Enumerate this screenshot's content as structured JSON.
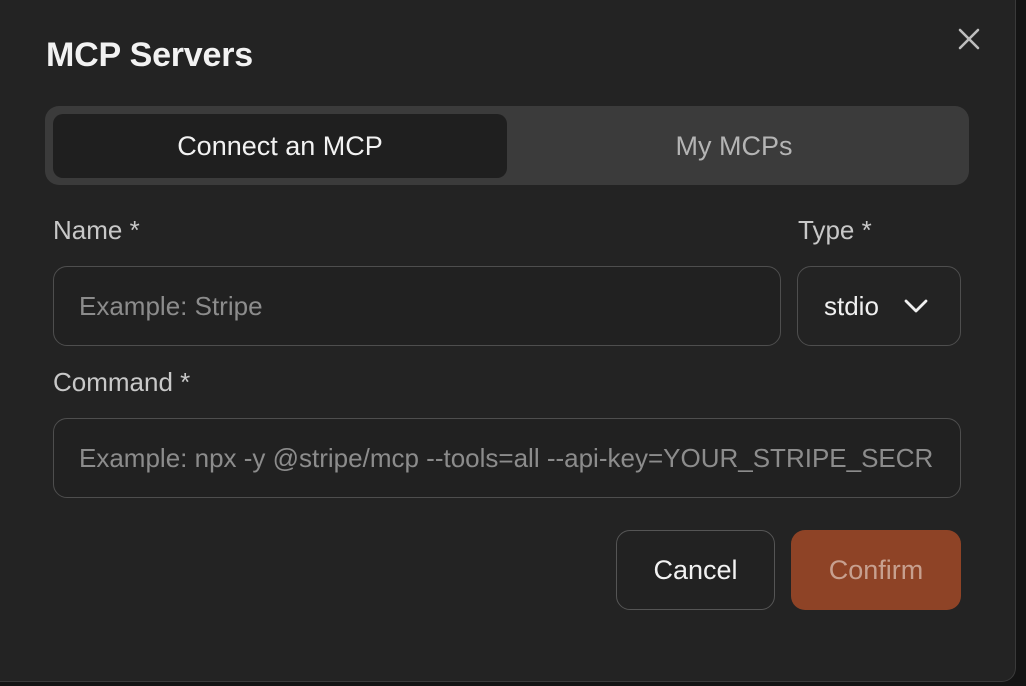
{
  "dialog": {
    "title": "MCP Servers",
    "close_icon": "close-icon"
  },
  "tabs": [
    {
      "label": "Connect an MCP",
      "active": true
    },
    {
      "label": "My MCPs",
      "active": false
    }
  ],
  "form": {
    "name": {
      "label": "Name *",
      "placeholder": "Example: Stripe",
      "value": ""
    },
    "type": {
      "label": "Type *",
      "selected": "stdio",
      "icon": "chevron-down-icon"
    },
    "command": {
      "label": "Command *",
      "placeholder": "Example: npx -y @stripe/mcp --tools=all --api-key=YOUR_STRIPE_SECRET_KEY",
      "value": ""
    }
  },
  "actions": {
    "cancel_label": "Cancel",
    "confirm_label": "Confirm"
  },
  "colors": {
    "background": "#232323",
    "accent": "#8e4326",
    "tab_track": "#3b3b3b"
  }
}
